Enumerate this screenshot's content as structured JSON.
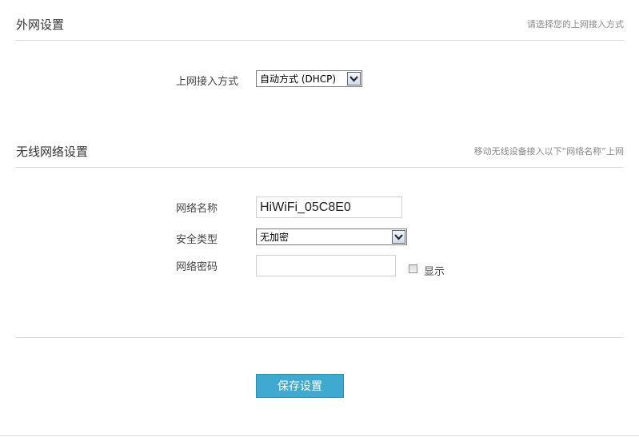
{
  "wan": {
    "title": "外网设置",
    "hint": "请选择您的上网接入方式",
    "access_label": "上网接入方式",
    "access_value": "自动方式 (DHCP)"
  },
  "wireless": {
    "title": "无线网络设置",
    "hint": "移动无线设备接入以下“网络名称”上网",
    "ssid_label": "网络名称",
    "ssid_value": "HiWiFi_05C8E0",
    "security_label": "安全类型",
    "security_value": "无加密",
    "password_label": "网络密码",
    "password_value": "",
    "show_label": "显示",
    "show_checked": false
  },
  "actions": {
    "save_label": "保存设置"
  }
}
